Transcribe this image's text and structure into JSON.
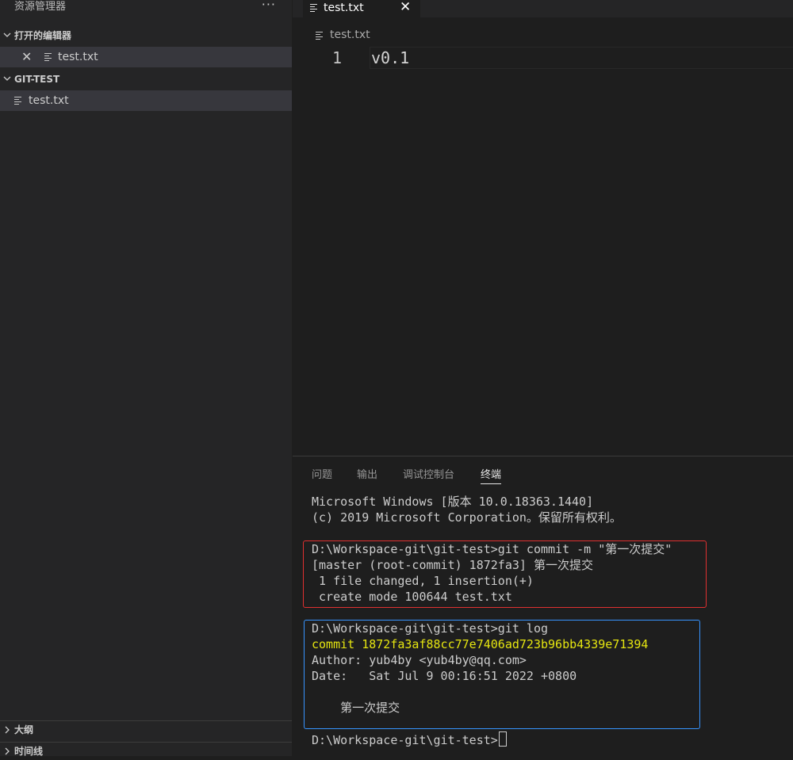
{
  "sidebar": {
    "title": "资源管理器",
    "more_icon": "ellipsis-icon",
    "open_editors": {
      "label": "打开的编辑器",
      "items": [
        {
          "name": "test.txt"
        }
      ]
    },
    "workspace": {
      "label": "GIT-TEST",
      "items": [
        {
          "name": "test.txt"
        }
      ]
    },
    "outline_label": "大纲",
    "timeline_label": "时间线"
  },
  "editor": {
    "tab_label": "test.txt",
    "breadcrumb": "test.txt",
    "lines": [
      {
        "number": "1",
        "text": "v0.1"
      }
    ]
  },
  "panel": {
    "tabs": [
      "问题",
      "输出",
      "调试控制台",
      "终端"
    ],
    "active_tab": "终端",
    "terminal": {
      "header": [
        "Microsoft Windows [版本 10.0.18363.1440]",
        "(c) 2019 Microsoft Corporation。保留所有权利。"
      ],
      "commit_block": [
        "D:\\Workspace-git\\git-test>git commit -m \"第一次提交\"",
        "[master (root-commit) 1872fa3] 第一次提交",
        " 1 file changed, 1 insertion(+)",
        " create mode 100644 test.txt"
      ],
      "log_block": {
        "prompt": "D:\\Workspace-git\\git-test>git log",
        "commit": "commit 1872fa3af88cc77e7406ad723b96bb4339e71394",
        "author": "Author: yub4by <yub4by@qq.com>",
        "date": "Date:   Sat Jul 9 00:16:51 2022 +0800",
        "message": "    第一次提交"
      },
      "prompt": "D:\\Workspace-git\\git-test>"
    }
  },
  "colors": {
    "accent_blue": "#3794ff",
    "highlight_red": "#e03030",
    "commit_yellow": "#e5e510"
  }
}
